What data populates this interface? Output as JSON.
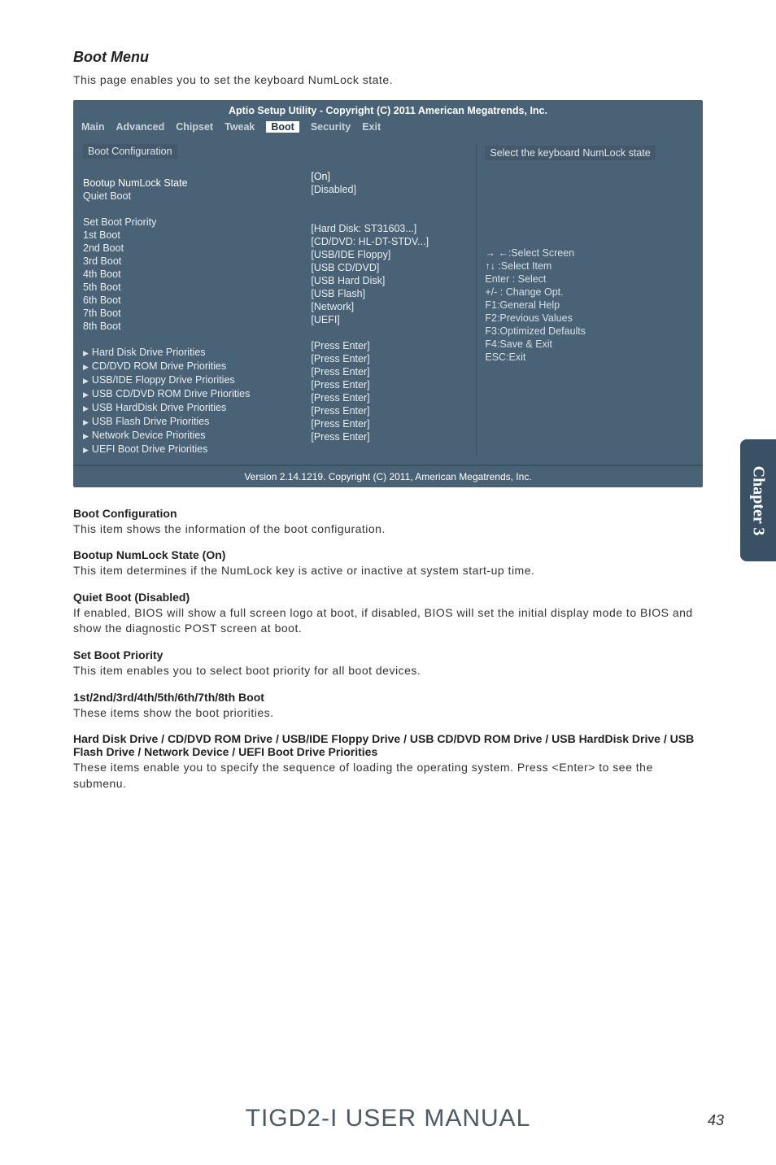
{
  "section_title": "Boot Menu",
  "intro": "This page enables you to set the keyboard NumLock state.",
  "bios": {
    "title": "Aptio Setup Utility - Copyright (C) 2011 American Megatrends, Inc.",
    "tabs": [
      "Main",
      "Advanced",
      "Chipset",
      "Tweak",
      "Boot",
      "Security",
      "Exit"
    ],
    "active_tab": "Boot",
    "left_block_heading": "Boot Configuration",
    "rows1": [
      {
        "label": "Bootup NumLock State",
        "value": "[On]",
        "hl": true
      },
      {
        "label": "Quiet Boot",
        "value": "[Disabled]"
      }
    ],
    "set_priority": "Set Boot Priority",
    "rows2": [
      {
        "label": "1st Boot",
        "value": "[Hard Disk: ST31603...]"
      },
      {
        "label": "2nd Boot",
        "value": "[CD/DVD: HL-DT-STDV...]"
      },
      {
        "label": "3rd Boot",
        "value": "[USB/IDE Floppy]"
      },
      {
        "label": "4th Boot",
        "value": "[USB CD/DVD]"
      },
      {
        "label": "5th Boot",
        "value": "[USB Hard Disk]"
      },
      {
        "label": "6th Boot",
        "value": "[USB Flash]"
      },
      {
        "label": "7th Boot",
        "value": "[Network]"
      },
      {
        "label": "8th Boot",
        "value": "[UEFI]"
      }
    ],
    "submenus": [
      {
        "label": "Hard Disk Drive Priorities",
        "value": "[Press Enter]"
      },
      {
        "label": "CD/DVD ROM Drive Priorities",
        "value": "[Press Enter]"
      },
      {
        "label": "USB/IDE Floppy Drive Priorities",
        "value": "[Press Enter]"
      },
      {
        "label": "USB CD/DVD ROM Drive Priorities",
        "value": "[Press Enter]"
      },
      {
        "label": "USB HardDisk Drive Priorities",
        "value": "[Press Enter]"
      },
      {
        "label": "USB Flash Drive Priorities",
        "value": "[Press Enter]"
      },
      {
        "label": "Network Device Priorities",
        "value": "[Press Enter]"
      },
      {
        "label": "UEFI Boot Drive Priorities",
        "value": "[Press Enter]"
      }
    ],
    "help_top": "Select the keyboard NumLock state",
    "help_keys": [
      "→ ←:Select Screen",
      "↑↓ :Select Item",
      "Enter : Select",
      "+/-  : Change Opt.",
      "F1:General Help",
      "F2:Previous Values",
      "F3:Optimized Defaults",
      "F4:Save & Exit",
      "ESC:Exit"
    ],
    "footer": "Version  2.14.1219.  Copyright (C) 2011, American Megatrends, Inc."
  },
  "desc": [
    {
      "h": "Boot Configuration",
      "p": "This item shows the information of the boot configuration."
    },
    {
      "h": "Bootup NumLock State (On)",
      "p": "This item determines if the NumLock key is active or inactive at system start-up time."
    },
    {
      "h": "Quiet Boot (Disabled)",
      "p": "If enabled, BIOS will show a full screen logo at boot, if disabled, BIOS will set the initial display mode to BIOS and show the diagnostic POST screen at boot."
    },
    {
      "h": "Set Boot Priority",
      "p": "This item enables you to select boot priority for all boot devices."
    },
    {
      "h": "1st/2nd/3rd/4th/5th/6th/7th/8th Boot",
      "p": "These items show the boot priorities."
    },
    {
      "h": "Hard Disk Drive / CD/DVD ROM Drive / USB/IDE Floppy Drive / USB CD/DVD ROM Drive / USB HardDisk Drive / USB Flash Drive / Network Device / UEFI Boot Drive Priorities",
      "p": "These items enable you to specify the sequence of loading the operating system. Press <Enter> to see the submenu."
    }
  ],
  "side_tab": "Chapter 3",
  "manual_title": "TIGD2-I USER MANUAL",
  "page_num": "43"
}
